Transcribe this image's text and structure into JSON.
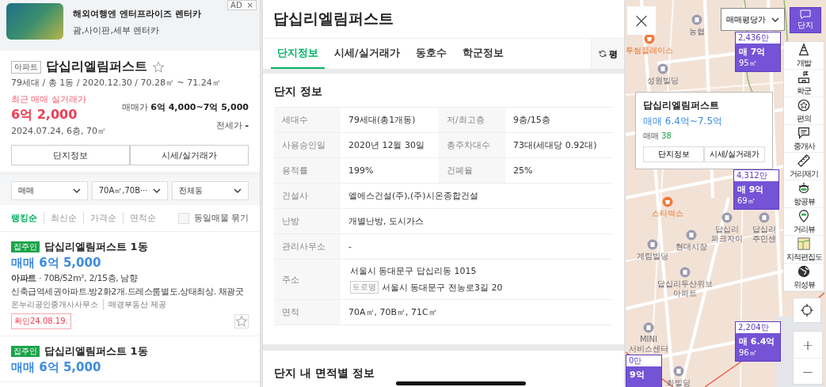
{
  "ad": {
    "badge": "AD",
    "close": "×",
    "title": "해외여행엔 엔터프라이즈 렌터카",
    "subtitle": "괌,사이판,세부 렌터카"
  },
  "complex": {
    "type_tag": "아파트",
    "name": "답십리엘림퍼스트",
    "favorite": false,
    "summary": "79세대 / 총 1동 / 2020.12.30 / 70.28㎡ ~ 71.24㎡",
    "recent_label": "최근 매매 실거래가",
    "recent_price": "6억 2,000",
    "recent_detail": "2024.07.24, 6층, 70㎡",
    "sale_label": "매매가",
    "sale_value": "6억 4,000~7억 5,000",
    "jeonse_label": "전세가",
    "jeonse_value": "-",
    "buttons": [
      "단지정보",
      "시세/실거래가"
    ]
  },
  "filters": [
    "매매",
    "70A㎡,70B⋯",
    "전체동"
  ],
  "sort": [
    {
      "label": "랭킹순",
      "selected": true
    },
    {
      "label": "최신순",
      "selected": false
    },
    {
      "label": "가격순",
      "selected": false
    },
    {
      "label": "면적순",
      "selected": false
    }
  ],
  "group_same": {
    "label": "동일매물 묶기",
    "checked": false
  },
  "listings": [
    {
      "badge": "집주인",
      "title": "답십리엘림퍼스트 1동",
      "price": "매매 6억 5,000",
      "type": "아파트",
      "spec": "· 70B/52m², 2/15층, 남향",
      "description": "신축급역세권아파트.방2화2개.드레스룸별도.상태최상. 채광굿",
      "agent": "온누리공인중개사사무소",
      "provider": "매경부동산 제공",
      "confirmed": "확인24.08.19.",
      "favorite": false
    },
    {
      "badge": "집주인",
      "title": "답십리엘림퍼스트 1동",
      "price": "매매 6억 5,000"
    }
  ],
  "detail": {
    "title": "답십리엘림퍼스트",
    "tabs": [
      {
        "label": "단지정보",
        "selected": true
      },
      {
        "label": "시세/실거래가",
        "selected": false
      },
      {
        "label": "동호수",
        "selected": false
      },
      {
        "label": "학군정보",
        "selected": false
      }
    ],
    "unit_button": "평",
    "section_title": "단지 정보",
    "rows": [
      {
        "label": "세대수",
        "value": "79세대(총1개동)",
        "label_2": "저/최고층",
        "value_2": "9층/15층"
      },
      {
        "label": "사용승인일",
        "value": "2020년 12월 30일",
        "label_2": "총주차대수",
        "value_2": "73대(세대당 0.92대)"
      },
      {
        "label": "용적률",
        "value": "199%",
        "label_2": "건폐율",
        "value_2": "25%"
      },
      {
        "label": "건설사",
        "value": "엘에스건설(주),(주)시온종합건설"
      },
      {
        "label": "난방",
        "value": "개별난방, 도시가스"
      },
      {
        "label": "관리사무소",
        "value": "-"
      },
      {
        "label": "주소",
        "value": "서울시 동대문구 답십리동 1015",
        "road_tag": "도로명",
        "road_value": "서울시 동대문구 전농로3길 20"
      },
      {
        "label": "면적",
        "value": "70A㎡, 70B㎡, 71C㎡"
      }
    ],
    "next_section_title": "단지 내 면적별 정보"
  },
  "map": {
    "close": "×",
    "price_type": "매매평당가",
    "danji_toggle": {
      "label": "단지",
      "selected": true
    },
    "places": [
      {
        "name": "투썸플레이스",
        "kind": "brand"
      },
      {
        "name": "농협",
        "kind": "poi"
      },
      {
        "name": "성원빌딩",
        "kind": "poi"
      },
      {
        "name": "스타벅스",
        "kind": "brand"
      },
      {
        "name": "답십리\n파크자이",
        "kind": "poi"
      },
      {
        "name": "현대시장",
        "kind": "poi"
      },
      {
        "name": "계림빌딩",
        "kind": "poi"
      },
      {
        "name": "답십리두산위브\n아파트",
        "kind": "poi"
      },
      {
        "name": "답십리\n주민센",
        "kind": "poi"
      },
      {
        "name": "MINI\n서비스센터",
        "kind": "poi"
      },
      {
        "name": "화빌딩",
        "kind": "poi"
      }
    ],
    "markers": [
      {
        "per_pyeong": "2,436만",
        "price": "매 7억",
        "area": "95㎡"
      },
      {
        "per_pyeong": "4,312만",
        "price": "매 9억",
        "area": "69㎡"
      },
      {
        "per_pyeong": "2,204만",
        "price": "매 6.4억",
        "area": "96㎡"
      },
      {
        "per_pyeong": "0만",
        "price": "9억"
      }
    ],
    "popup": {
      "name": "답십리엘림퍼스트",
      "price": "매매 6.4억~7.5억",
      "count_label": "매매",
      "count": "38",
      "buttons": [
        "단지정보",
        "시세/실거래가"
      ]
    },
    "tools": [
      {
        "label": "개발",
        "kind": "cone"
      },
      {
        "label": "학군",
        "kind": "school"
      },
      {
        "label": "편의",
        "kind": "star"
      },
      {
        "label": "중개사",
        "kind": "chat"
      },
      {
        "label": "거리재기",
        "kind": "ruler"
      },
      {
        "label": "항공뷰",
        "kind": "drone"
      },
      {
        "label": "거리뷰",
        "kind": "pin"
      },
      {
        "label": "지적편집도",
        "kind": "cadastral"
      },
      {
        "label": "위성뷰",
        "kind": "globe"
      }
    ],
    "zoom": [
      "+",
      "−"
    ]
  }
}
